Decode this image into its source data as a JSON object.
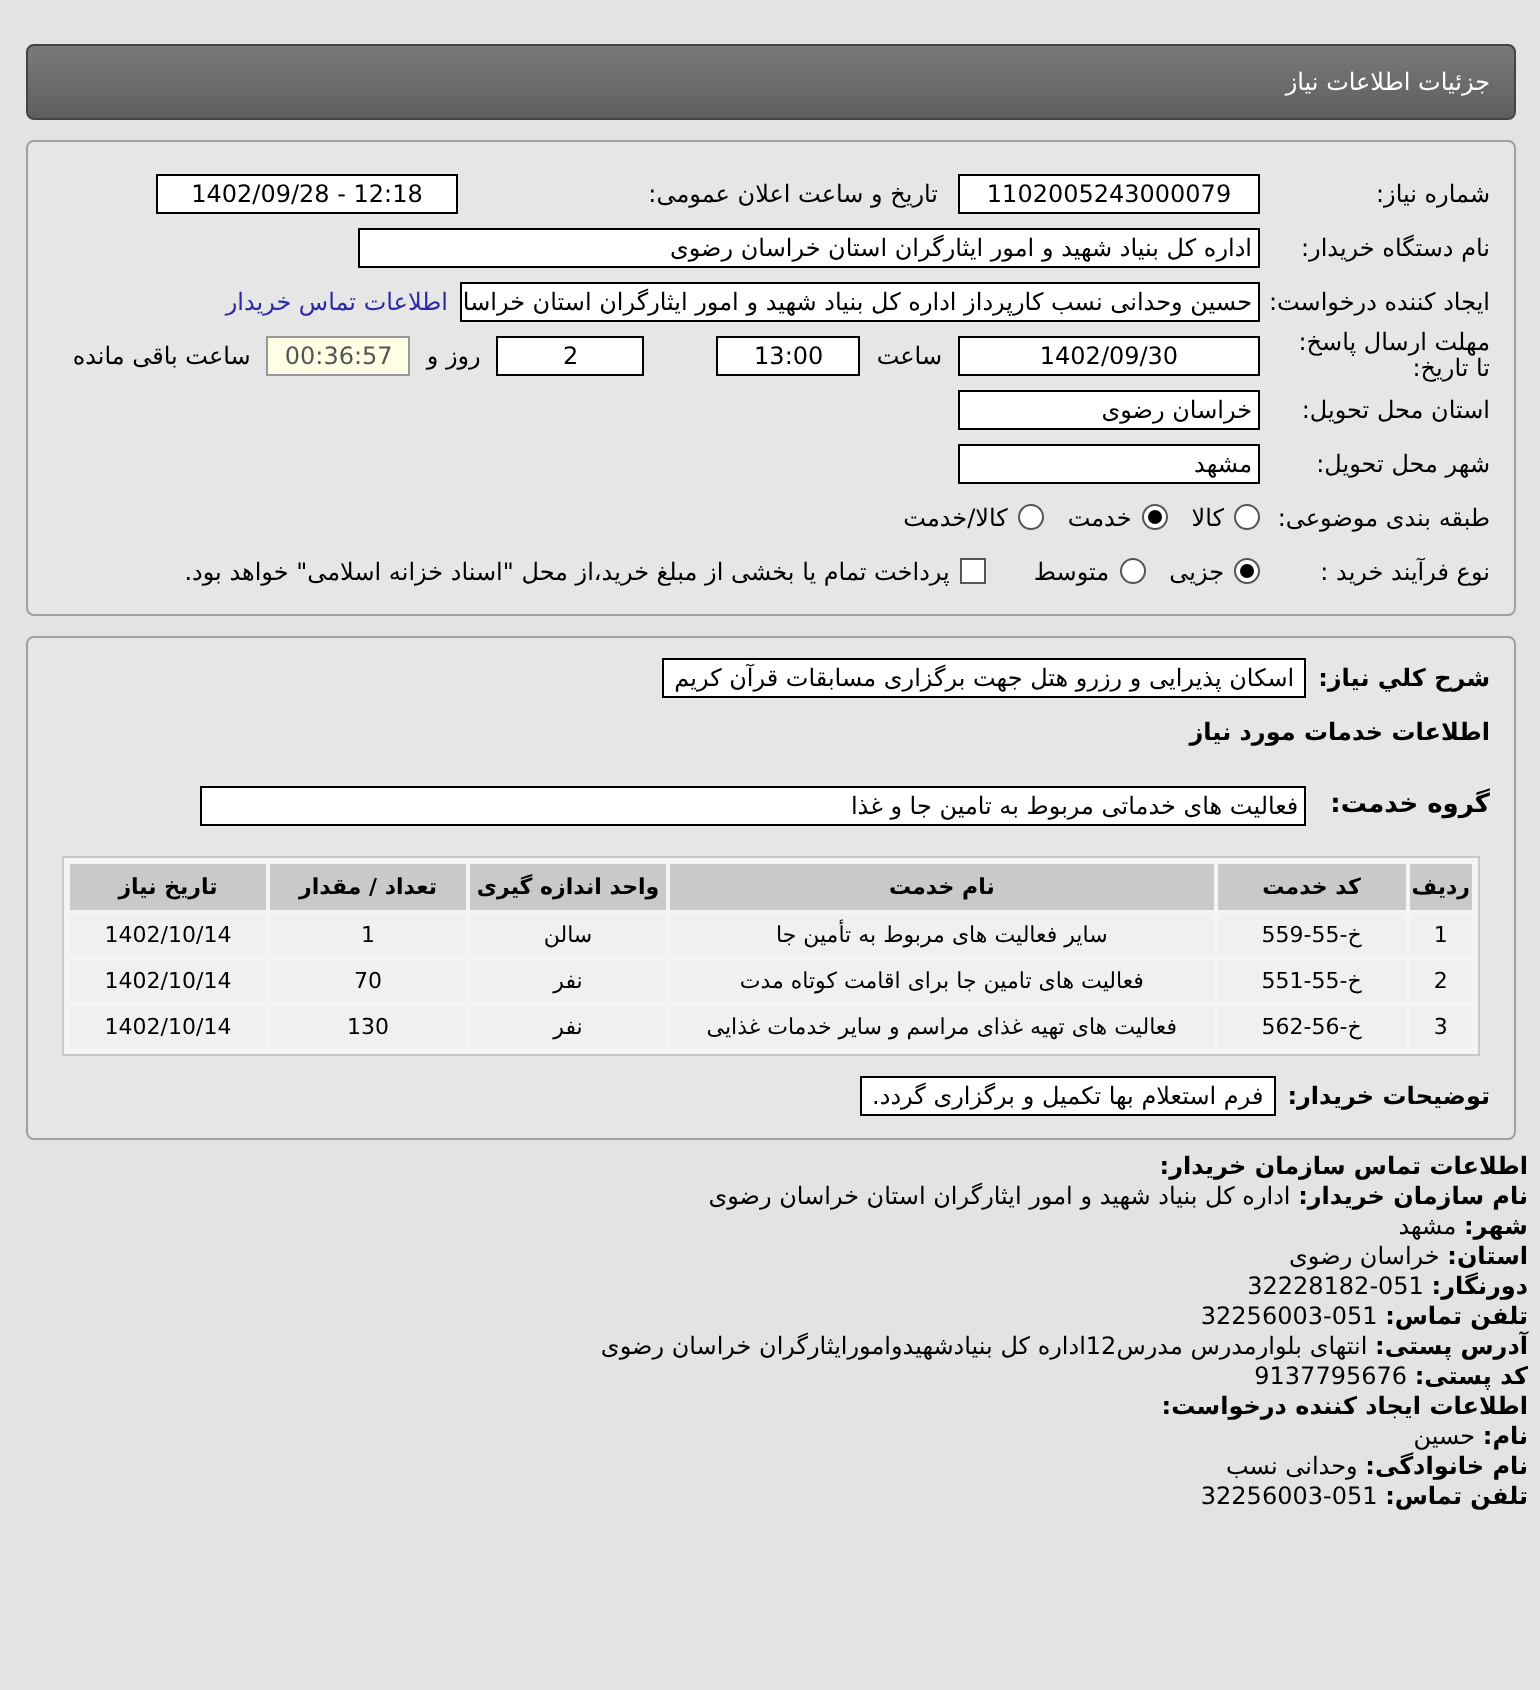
{
  "header": {
    "title": "جزئیات اطلاعات نیاز"
  },
  "details": {
    "need_number": {
      "label": "شماره نیاز:",
      "value": "1102005243000079"
    },
    "announce": {
      "label": "تاریخ و ساعت اعلان عمومی:",
      "value": "1402/09/28 - 12:18"
    },
    "buyer": {
      "label": "نام دستگاه خریدار:",
      "value": "اداره کل بنیاد شهید و امور ایثارگران استان خراسان رضوی"
    },
    "creator": {
      "label": "ایجاد کننده درخواست:",
      "value": "حسین وحدانی نسب کارپرداز اداره کل بنیاد شهید و امور ایثارگران استان خراسا",
      "link": "اطلاعات تماس خریدار"
    },
    "deadline": {
      "label": "مهلت ارسال پاسخ: تا تاریخ:",
      "date": "1402/09/30",
      "time_label": "ساعت",
      "time": "13:00",
      "days": "2",
      "days_label": "روز و",
      "remaining": "00:36:57",
      "remaining_label": "ساعت باقی مانده"
    },
    "province": {
      "label": "استان محل تحویل:",
      "value": "خراسان رضوی"
    },
    "city": {
      "label": "شهر محل تحویل:",
      "value": "مشهد"
    },
    "category": {
      "label": "طبقه بندی موضوعی:",
      "options": [
        {
          "label": "کالا",
          "selected": false
        },
        {
          "label": "خدمت",
          "selected": true
        },
        {
          "label": "کالا/خدمت",
          "selected": false
        }
      ]
    },
    "process": {
      "label": "نوع فرآیند خرید :",
      "options": [
        {
          "label": "جزیی",
          "selected": true
        },
        {
          "label": "متوسط",
          "selected": false
        }
      ],
      "payment": {
        "label": "پرداخت تمام یا بخشی از مبلغ خرید،از محل \"اسناد خزانه اسلامی\" خواهد بود.",
        "checked": false
      }
    }
  },
  "needs": {
    "summary_label": "شرح کلي نیاز:",
    "summary": "اسکان پذیرایی و رزرو هتل جهت برگزاری مسابقات قرآن کریم",
    "services_title": "اطلاعات خدمات مورد نیاز",
    "group_label": "گروه خدمت:",
    "group": "فعالیت های خدماتی مربوط به تامین جا و غذا",
    "table": {
      "columns": [
        "ردیف",
        "کد خدمت",
        "نام خدمت",
        "واحد اندازه گیری",
        "تعداد / مقدار",
        "تاریخ نیاز"
      ],
      "rows": [
        [
          "1",
          "خ-55-559",
          "سایر فعالیت های مربوط به تأمین جا",
          "سالن",
          "1",
          "1402/10/14"
        ],
        [
          "2",
          "خ-55-551",
          "فعالیت های تامین جا برای اقامت کوتاه مدت",
          "نفر",
          "70",
          "1402/10/14"
        ],
        [
          "3",
          "خ-56-562",
          "فعالیت های تهیه غذای مراسم و سایر خدمات غذایی",
          "نفر",
          "130",
          "1402/10/14"
        ]
      ]
    },
    "notes_label": "توضیحات خریدار:",
    "notes": "فرم استعلام بها تکمیل و برگزاری گردد."
  },
  "contact": [
    {
      "kind": "heading",
      "text": "اطلاعات تماس سازمان خریدار:"
    },
    {
      "kind": "line",
      "text": "**نام سازمان خریدار:** اداره کل بنیاد شهید و امور ایثارگران استان خراسان رضوی"
    },
    {
      "kind": "line",
      "text": "**شهر:** مشهد"
    },
    {
      "kind": "line",
      "text": "**استان:** خراسان رضوی"
    },
    {
      "kind": "line",
      "text": "**دورنگار:** 051-32228182"
    },
    {
      "kind": "line",
      "text": "**تلفن تماس:** 051-32256003"
    },
    {
      "kind": "line",
      "text": "**آدرس پستی:** انتهای بلوارمدرس مدرس12اداره کل بنیادشهیدوامورایثارگران خراسان رضوی"
    },
    {
      "kind": "line",
      "text": "**کد پستی:** 9137795676"
    },
    {
      "kind": "heading",
      "text": "اطلاعات ایجاد کننده درخواست:"
    },
    {
      "kind": "line",
      "text": "**نام:** حسین"
    },
    {
      "kind": "line",
      "text": "**نام خانوادگی:** وحدانی نسب"
    },
    {
      "kind": "line",
      "text": "**تلفن تماس:** 051-32256003"
    }
  ]
}
